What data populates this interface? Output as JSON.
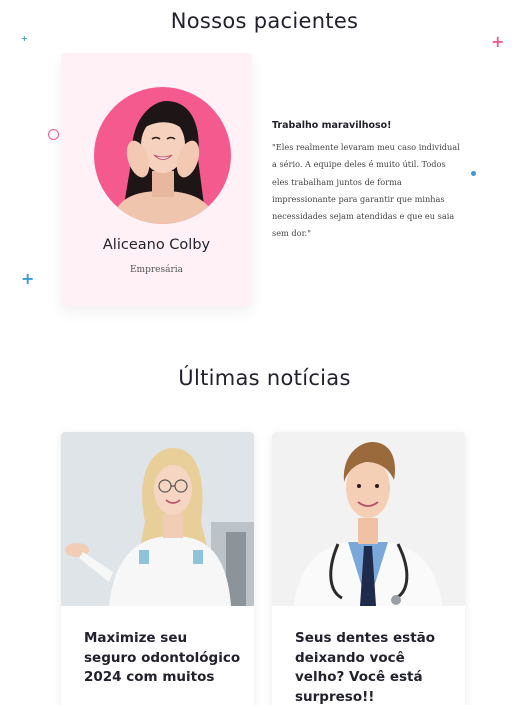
{
  "testimonials": {
    "heading": "Nossos pacientes",
    "patient": {
      "name": "Aliceano Colby",
      "role": "Empresária",
      "quote_title": "Trabalho maravilhoso!",
      "quote_text": "\"Eles realmente levaram meu caso individual a sério. A equipe deles é muito útil. Todos eles trabalham juntos de forma impressionante para garantir que minhas necessidades sejam atendidas e que eu saia sem dor.\""
    }
  },
  "news": {
    "heading": "Últimas notícias",
    "articles": [
      {
        "title": "Maximize seu seguro odontológico 2024 com muitos"
      },
      {
        "title": "Seus dentes estão deixando você velho? Você está surpreso!!"
      }
    ]
  },
  "colors": {
    "accent_pink": "#f55a8f",
    "accent_blue": "#3a9bd6",
    "card_pink_bg": "#fff1f6"
  }
}
